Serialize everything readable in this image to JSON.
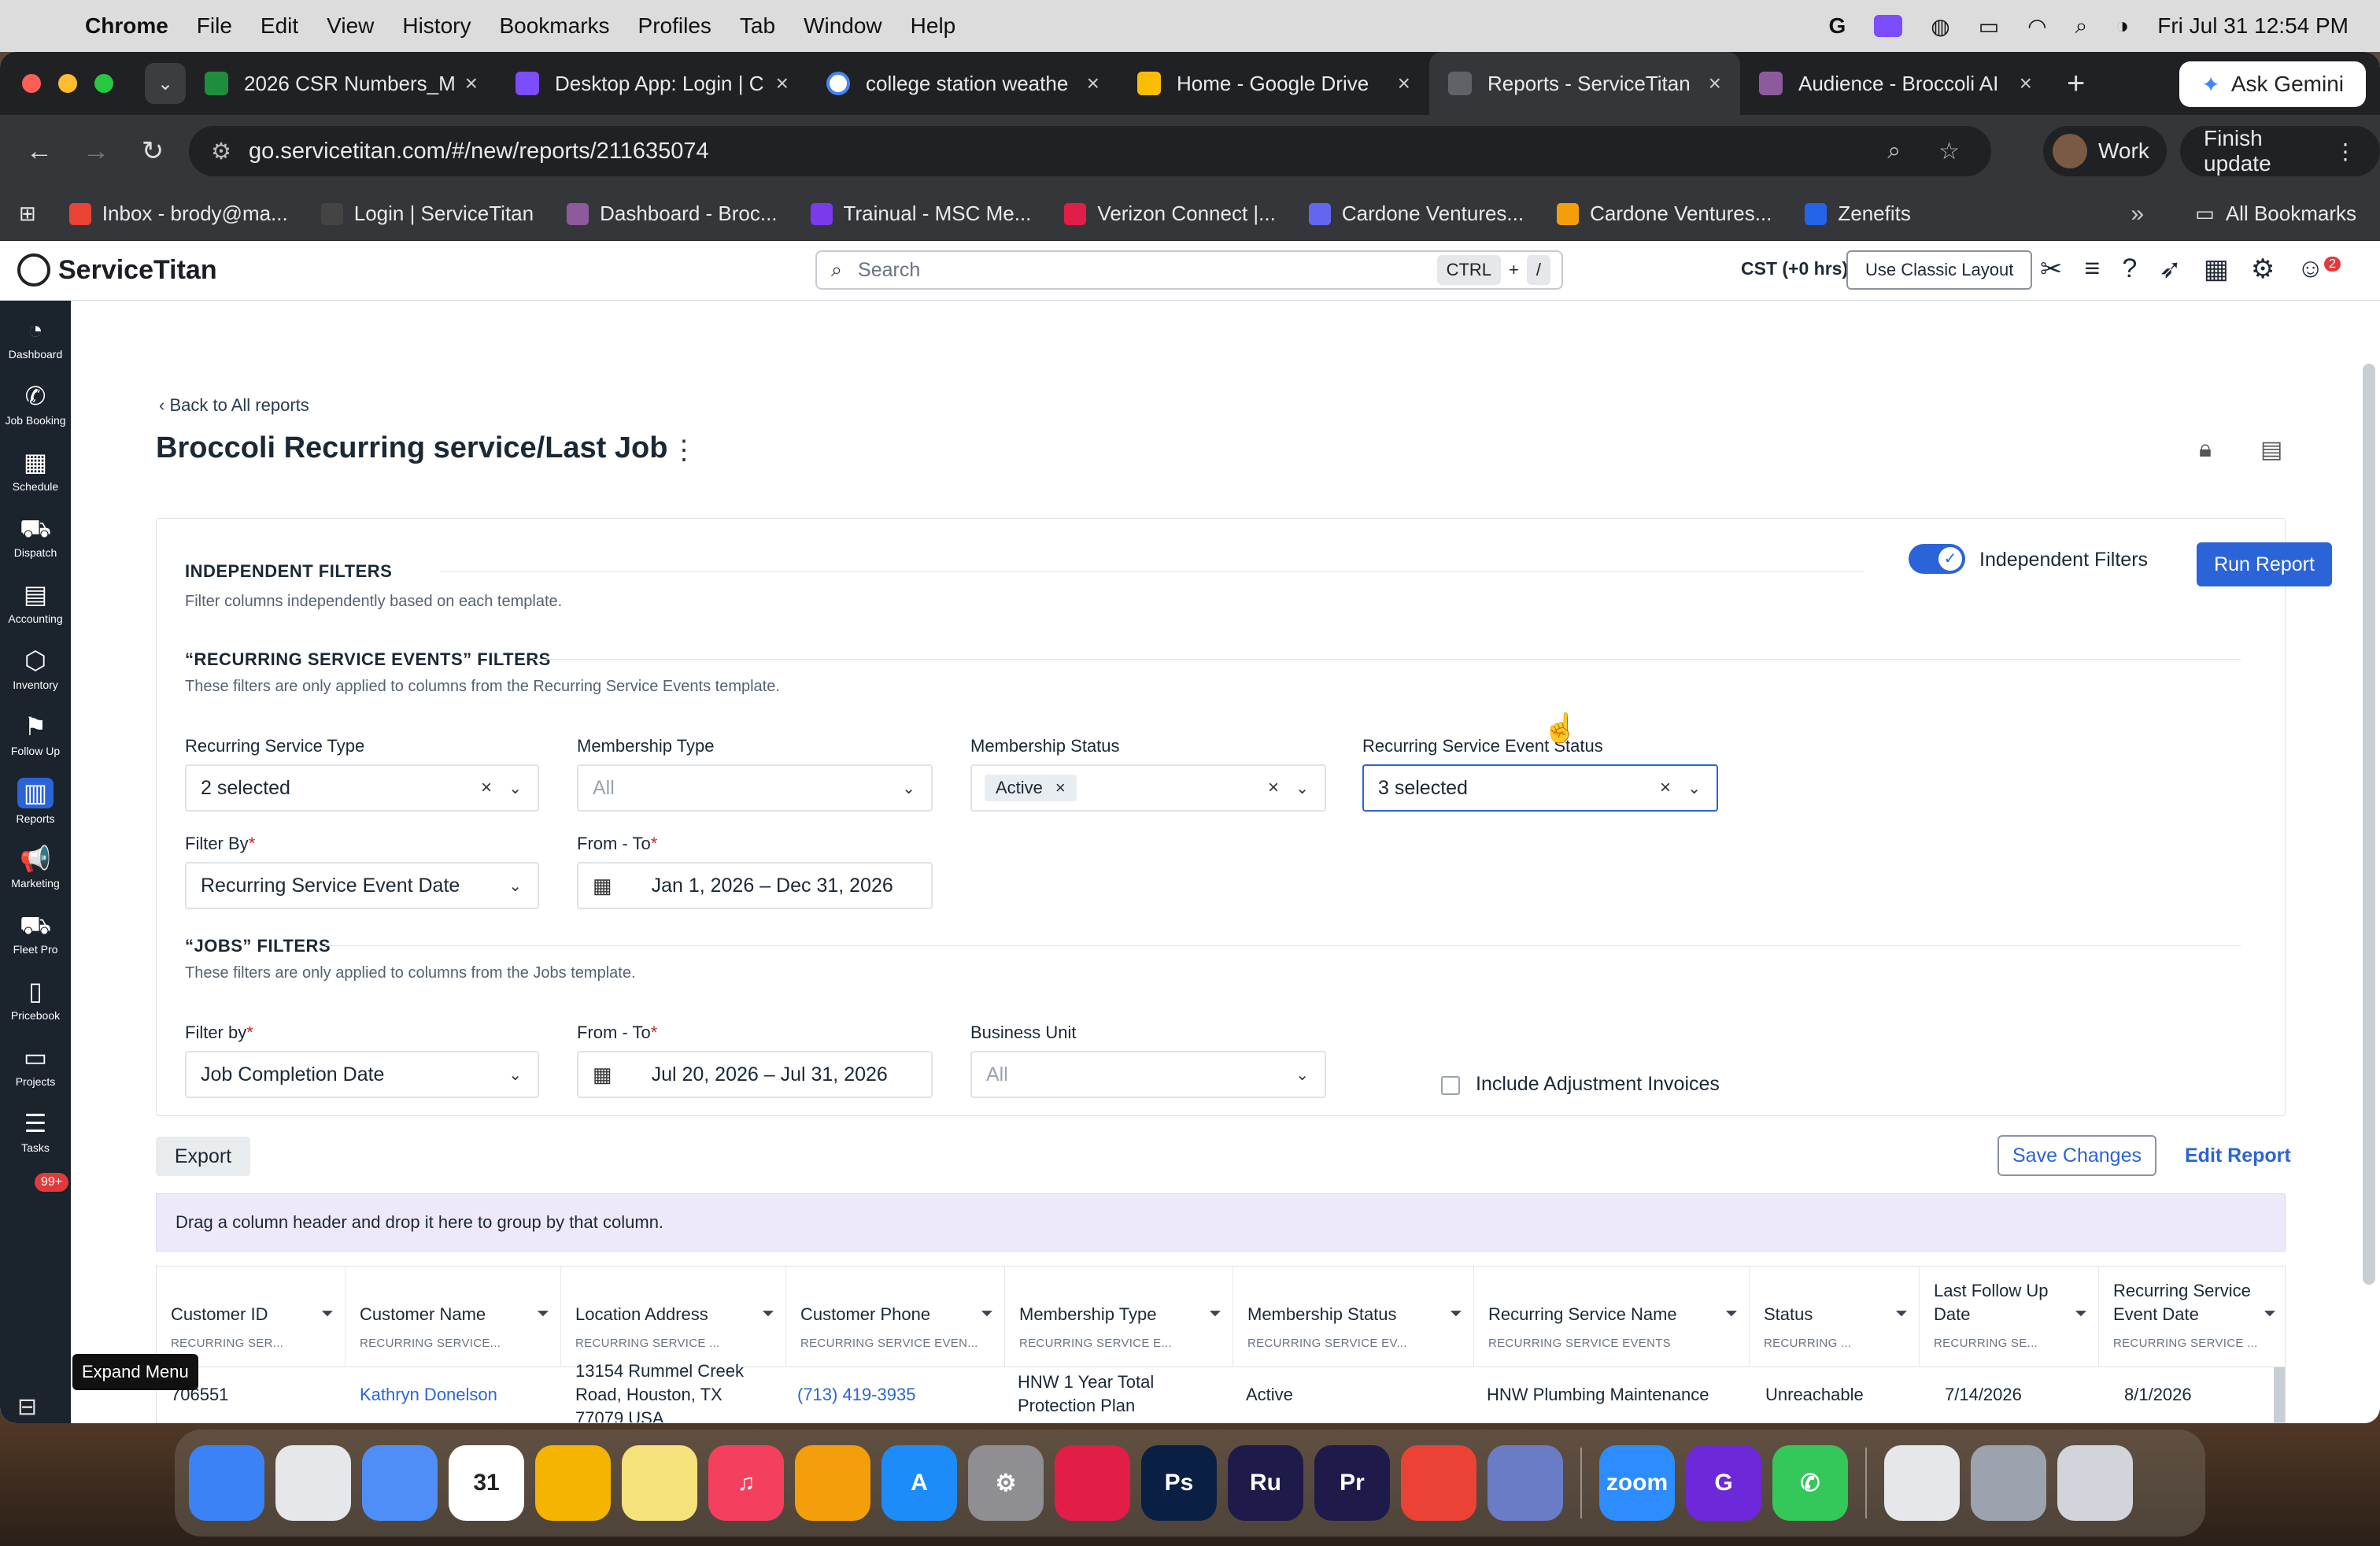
{
  "menubar": {
    "app": "Chrome",
    "items": [
      "File",
      "Edit",
      "View",
      "History",
      "Bookmarks",
      "Profiles",
      "Tab",
      "Window",
      "Help"
    ],
    "datetime": "Fri Jul 31  12:54 PM"
  },
  "tabs": [
    {
      "title": "2026 CSR Numbers_M",
      "color": "#1e8e3e"
    },
    {
      "title": "Desktop App: Login | C",
      "color": "#7c4dff"
    },
    {
      "title": "college station weathe",
      "color": "#4285f4"
    },
    {
      "title": "Home - Google Drive",
      "color": "#fbbc04"
    },
    {
      "title": "Reports - ServiceTitan",
      "color": "#5f6368"
    },
    {
      "title": "Audience - Broccoli AI",
      "color": "#8e5a9e"
    }
  ],
  "browser": {
    "ask_gemini": "Ask Gemini",
    "url": "go.servicetitan.com/#/new/reports/211635074",
    "profile": "Work",
    "finish_update": "Finish update"
  },
  "bookmarks": {
    "items": [
      {
        "label": "Inbox - brody@ma...",
        "color": "#ea4335"
      },
      {
        "label": "Login | ServiceTitan",
        "color": "#444"
      },
      {
        "label": "Dashboard - Broc...",
        "color": "#8e5a9e"
      },
      {
        "label": "Trainual - MSC Me...",
        "color": "#7c3aed"
      },
      {
        "label": "Verizon Connect |...",
        "color": "#e11d48"
      },
      {
        "label": "Cardone Ventures...",
        "color": "#6366f1"
      },
      {
        "label": "Cardone Ventures...",
        "color": "#f59e0b"
      },
      {
        "label": "Zenefits",
        "color": "#2563eb"
      }
    ],
    "all": "All Bookmarks"
  },
  "st": {
    "logo": "ServiceTitan",
    "search_placeholder": "Search",
    "kbd_ctrl": "CTRL",
    "kbd_plus": "+",
    "kbd_slash": "/",
    "timezone": "CST (+0 hrs)",
    "classic_layout": "Use Classic Layout",
    "notif_count": "2"
  },
  "nav": [
    {
      "label": "Dashboard",
      "icon": "dashboard-icon",
      "glyph": "◔"
    },
    {
      "label": "Job Booking",
      "icon": "phone-icon",
      "glyph": "✆"
    },
    {
      "label": "Schedule",
      "icon": "calendar-icon",
      "glyph": "▦"
    },
    {
      "label": "Dispatch",
      "icon": "truck-icon",
      "glyph": "⛟"
    },
    {
      "label": "Accounting",
      "icon": "ledger-icon",
      "glyph": "▤"
    },
    {
      "label": "Inventory",
      "icon": "box-icon",
      "glyph": "⬡"
    },
    {
      "label": "Follow Up",
      "icon": "flag-icon",
      "glyph": "⚑"
    },
    {
      "label": "Reports",
      "icon": "chart-icon",
      "glyph": "▥"
    },
    {
      "label": "Marketing",
      "icon": "megaphone-icon",
      "glyph": "📢"
    },
    {
      "label": "Fleet Pro",
      "icon": "fleet-icon",
      "glyph": "⛟"
    },
    {
      "label": "Pricebook",
      "icon": "book-icon",
      "glyph": "▯"
    },
    {
      "label": "Projects",
      "icon": "folder-icon",
      "glyph": "▭"
    },
    {
      "label": "Tasks",
      "icon": "tasks-icon",
      "glyph": "☰"
    }
  ],
  "nav_badge": "99+",
  "expand_menu": "Expand Menu",
  "report": {
    "back": "Back to All reports",
    "title": "Broccoli Recurring service/Last Job"
  },
  "filters": {
    "independent_title": "INDEPENDENT FILTERS",
    "independent_sub": "Filter columns independently based on each template.",
    "toggle_label": "Independent Filters",
    "run_report": "Run Report",
    "rse_title": "“RECURRING SERVICE EVENTS” FILTERS",
    "rse_sub": "These filters are only applied to columns from the Recurring Service Events template.",
    "recurring_service_type": {
      "label": "Recurring Service Type",
      "value": "2 selected"
    },
    "membership_type": {
      "label": "Membership Type",
      "placeholder": "All"
    },
    "membership_status": {
      "label": "Membership Status",
      "chip": "Active"
    },
    "rse_status": {
      "label": "Recurring Service Event Status",
      "value": "3 selected"
    },
    "filter_by": {
      "label": "Filter By",
      "value": "Recurring Service Event Date"
    },
    "from_to": {
      "label": "From - To",
      "value": "Jan 1, 2026 – Dec 31, 2026"
    },
    "jobs_title": "“JOBS” FILTERS",
    "jobs_sub": "These filters are only applied to columns from the Jobs template.",
    "jobs_filter_by": {
      "label": "Filter by",
      "value": "Job Completion Date"
    },
    "jobs_from_to": {
      "label": "From - To",
      "value": "Jul 20, 2026 – Jul 31, 2026"
    },
    "business_unit": {
      "label": "Business Unit",
      "placeholder": "All"
    },
    "include_adjustment": "Include Adjustment Invoices"
  },
  "actions": {
    "export": "Export",
    "save_changes": "Save Changes",
    "edit_report": "Edit Report"
  },
  "group_hint": "Drag a column header and drop it here to group by that column.",
  "grid": {
    "columns": [
      {
        "title": "Customer ID",
        "sub": "RECURRING SER..."
      },
      {
        "title": "Customer Name",
        "sub": "RECURRING SERVICE..."
      },
      {
        "title": "Location Address",
        "sub": "RECURRING SERVICE ..."
      },
      {
        "title": "Customer Phone",
        "sub": "RECURRING SERVICE EVEN..."
      },
      {
        "title": "Membership Type",
        "sub": "RECURRING SERVICE E..."
      },
      {
        "title": "Membership Status",
        "sub": "RECURRING SERVICE EV..."
      },
      {
        "title": "Recurring Service Name",
        "sub": "RECURRING SERVICE EVENTS"
      },
      {
        "title": "Status",
        "sub": "RECURRING ..."
      },
      {
        "title": "Last Follow Up Date",
        "sub": "RECURRING SE..."
      },
      {
        "title": "Recurring Service Event Date",
        "sub": "RECURRING SERVICE ..."
      }
    ],
    "row": {
      "customer_id": "706551",
      "customer_name": "Kathryn Donelson",
      "address": "13154 Rummel Creek Road, Houston, TX 77079 USA",
      "phone": "(713) 419-3935",
      "membership_type": "HNW 1 Year Total Protection Plan",
      "membership_status": "Active",
      "service_name": "HNW Plumbing Maintenance",
      "status": "Unreachable",
      "last_follow_up": "7/14/2026",
      "event_date": "8/1/2026"
    }
  },
  "dock": [
    {
      "name": "finder",
      "label": "",
      "color": "#3b82f6"
    },
    {
      "name": "launchpad",
      "label": "",
      "color": "#e5e7eb"
    },
    {
      "name": "mail",
      "label": "",
      "color": "#4f8ef7"
    },
    {
      "name": "calendar",
      "label": "31",
      "color": "#ffffff"
    },
    {
      "name": "photos",
      "label": "",
      "color": "#f4b400"
    },
    {
      "name": "notes",
      "label": "",
      "color": "#f5e27a"
    },
    {
      "name": "music",
      "label": "♫",
      "color": "#f43f5e"
    },
    {
      "name": "pages",
      "label": "",
      "color": "#f59e0b"
    },
    {
      "name": "app-store",
      "label": "A",
      "color": "#1d8cf8"
    },
    {
      "name": "settings",
      "label": "⚙",
      "color": "#8e8e93"
    },
    {
      "name": "creative-cloud",
      "label": "",
      "color": "#e11d48"
    },
    {
      "name": "photoshop",
      "label": "Ps",
      "color": "#0a1f44"
    },
    {
      "name": "rush",
      "label": "Ru",
      "color": "#1e1b4b"
    },
    {
      "name": "premiere",
      "label": "Pr",
      "color": "#1e1b4b"
    },
    {
      "name": "chrome",
      "label": "",
      "color": "#ea4335"
    },
    {
      "name": "simulator",
      "label": "",
      "color": "#6b7cc7"
    },
    {
      "name": "zoom",
      "label": "zoom",
      "color": "#2d8cff"
    },
    {
      "name": "g-app",
      "label": "G",
      "color": "#6d28d9"
    },
    {
      "name": "phone",
      "label": "✆",
      "color": "#34c759"
    },
    {
      "name": "docs-stack",
      "label": "",
      "color": "#e5e7eb"
    },
    {
      "name": "downloads",
      "label": "",
      "color": "#9ca3af"
    },
    {
      "name": "trash",
      "label": "",
      "color": "#d1d5db"
    }
  ]
}
